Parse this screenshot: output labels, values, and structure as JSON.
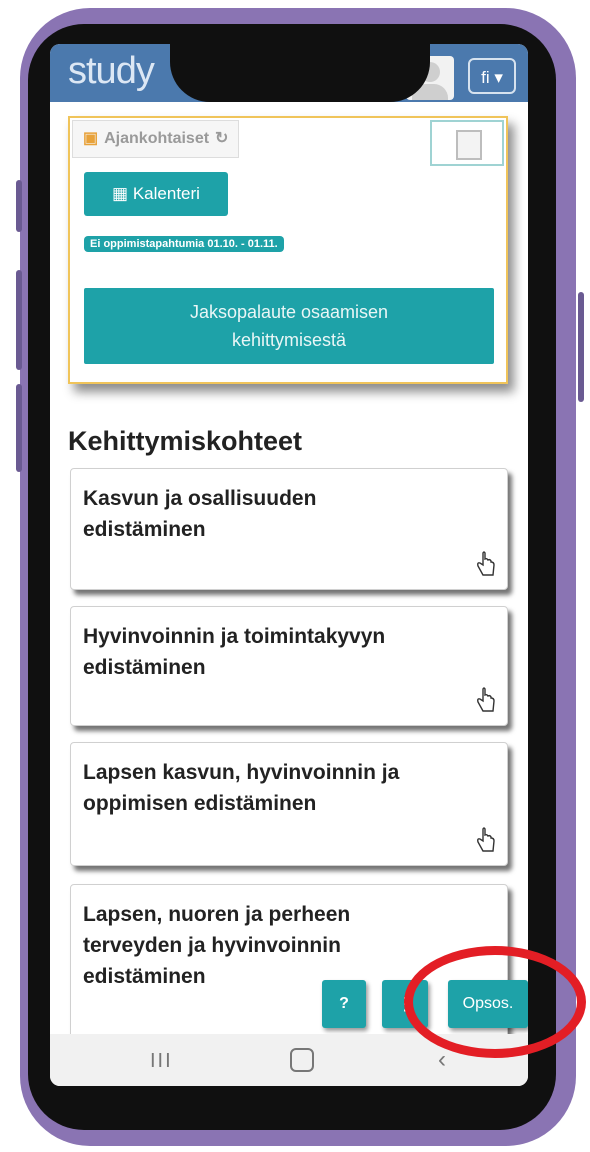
{
  "header": {
    "logo_text": "study",
    "language": "fi ▾"
  },
  "current_card": {
    "tab_label": "Ajankohtaiset",
    "calendar_button": "Kalenteri",
    "badge_text": "Ei oppimistapahtumia 01.10. - 01.11.",
    "feedback_button_line1": "Jaksopalaute osaamisen",
    "feedback_button_line2": "kehittymisestä"
  },
  "section": {
    "heading": "Kehittymiskohteet",
    "items": [
      {
        "line1": "Kasvun ja osallisuuden",
        "line2": "edistäminen",
        "line3": ""
      },
      {
        "line1": "Hyvinvoinnin ja toimintakyvyn",
        "line2": "edistäminen",
        "line3": ""
      },
      {
        "line1": "Lapsen kasvun, hyvinvoinnin ja",
        "line2": "oppimisen edistäminen",
        "line3": ""
      },
      {
        "line1": "Lapsen, nuoren ja perheen",
        "line2": "terveyden ja hyvinvoinnin",
        "line3": "edistäminen"
      }
    ]
  },
  "floating": {
    "help": "?",
    "opsos": "Opsos."
  },
  "colors": {
    "accent": "#1ea2a8",
    "topbar": "#4b79ad",
    "highlight_ring": "#e31e25"
  }
}
